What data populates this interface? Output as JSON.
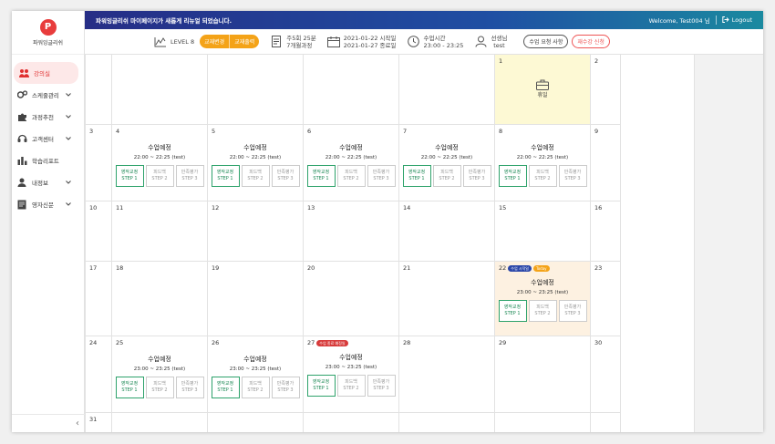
{
  "brand": {
    "logo_letter": "P",
    "name": "파워잉글리쉬"
  },
  "sidebar": {
    "items": [
      {
        "label": "강의실",
        "icon": "people-icon",
        "active": true,
        "arrow": false
      },
      {
        "label": "스케줄관리",
        "icon": "gears-icon",
        "active": false,
        "arrow": true
      },
      {
        "label": "과정추천",
        "icon": "puzzle-icon",
        "active": false,
        "arrow": true
      },
      {
        "label": "고객센터",
        "icon": "headset-icon",
        "active": false,
        "arrow": true
      },
      {
        "label": "학습리포트",
        "icon": "bar-chart-icon",
        "active": false,
        "arrow": false
      },
      {
        "label": "내정보",
        "icon": "user-icon",
        "active": false,
        "arrow": true
      },
      {
        "label": "영자신문",
        "icon": "newspaper-icon",
        "active": false,
        "arrow": true
      }
    ],
    "collapse_glyph": "‹"
  },
  "topbar": {
    "message": "파워잉글리쉬 마이페이지가 새롭게 리뉴얼 되었습니다.",
    "welcome": "Welcome, Test004 님",
    "logout": "Logout"
  },
  "infobar": {
    "level": "LEVEL 8",
    "btn_change_book": "교재변경",
    "btn_order_book": "교재출력",
    "schedule_line1": "주5회 25분",
    "schedule_line2": "7개월과정",
    "start_line": "2021-01-22  시작일",
    "end_line": "2021-01-27  종료일",
    "time_label": "수업시간",
    "time_value": "23:00 - 23:25",
    "teacher_label": "선생님",
    "teacher_value": "test",
    "btn_request": "수업 요청 사항",
    "btn_retake": "재수강 신청"
  },
  "colors": {
    "accent_red": "#e03030",
    "step_green": "#2ea26b",
    "topbar_start": "#262e86",
    "topbar_end": "#1b8aa0",
    "orange": "#f4a318"
  },
  "step_labels": [
    {
      "top": "영작교정",
      "bottom": "STEP 1"
    },
    {
      "top": "피드백",
      "bottom": "STEP 2"
    },
    {
      "top": "만족평가",
      "bottom": "STEP 3"
    }
  ],
  "calendar": {
    "rows": [
      {
        "days": [
          {
            "n": ""
          },
          {
            "n": ""
          },
          {
            "n": ""
          },
          {
            "n": ""
          },
          {
            "n": ""
          },
          {
            "n": "1",
            "holiday": "휴일"
          },
          {
            "n": "2"
          }
        ]
      },
      {
        "days": [
          {
            "n": "3"
          },
          {
            "n": "4",
            "lesson": {
              "title": "수업예정",
              "time": "22:00 ~ 22:25 (test)"
            }
          },
          {
            "n": "5",
            "lesson": {
              "title": "수업예정",
              "time": "22:00 ~ 22:25 (test)"
            }
          },
          {
            "n": "6",
            "lesson": {
              "title": "수업예정",
              "time": "22:00 ~ 22:25 (test)"
            }
          },
          {
            "n": "7",
            "lesson": {
              "title": "수업예정",
              "time": "22:00 ~ 22:25 (test)"
            }
          },
          {
            "n": "8",
            "lesson": {
              "title": "수업예정",
              "time": "22:00 ~ 22:25 (test)"
            }
          },
          {
            "n": "9"
          }
        ]
      },
      {
        "days": [
          {
            "n": "10"
          },
          {
            "n": "11"
          },
          {
            "n": "12"
          },
          {
            "n": "13"
          },
          {
            "n": "14"
          },
          {
            "n": "15"
          },
          {
            "n": "16"
          }
        ]
      },
      {
        "days": [
          {
            "n": "17"
          },
          {
            "n": "18"
          },
          {
            "n": "19"
          },
          {
            "n": "20"
          },
          {
            "n": "21"
          },
          {
            "n": "22",
            "today": true,
            "badges": [
              {
                "text": "수업 시작일",
                "color": "blue"
              },
              {
                "text": "Today",
                "color": "orange"
              }
            ],
            "lesson": {
              "title": "수업예정",
              "time": "23:00 ~ 23:25 (test)"
            }
          },
          {
            "n": "23"
          }
        ]
      },
      {
        "days": [
          {
            "n": "24"
          },
          {
            "n": "25",
            "lesson": {
              "title": "수업예정",
              "time": "23:00 ~ 23:25 (test)"
            }
          },
          {
            "n": "26",
            "lesson": {
              "title": "수업예정",
              "time": "23:00 ~ 23:25 (test)"
            }
          },
          {
            "n": "27",
            "badges": [
              {
                "text": "수업 종료 예정일",
                "color": "red"
              }
            ],
            "lesson": {
              "title": "수업예정",
              "time": "23:00 ~ 23:25 (test)"
            }
          },
          {
            "n": "28"
          },
          {
            "n": "29"
          },
          {
            "n": "30"
          }
        ]
      },
      {
        "days": [
          {
            "n": "31"
          },
          {
            "n": ""
          },
          {
            "n": ""
          },
          {
            "n": ""
          },
          {
            "n": ""
          },
          {
            "n": ""
          },
          {
            "n": ""
          }
        ]
      }
    ]
  }
}
